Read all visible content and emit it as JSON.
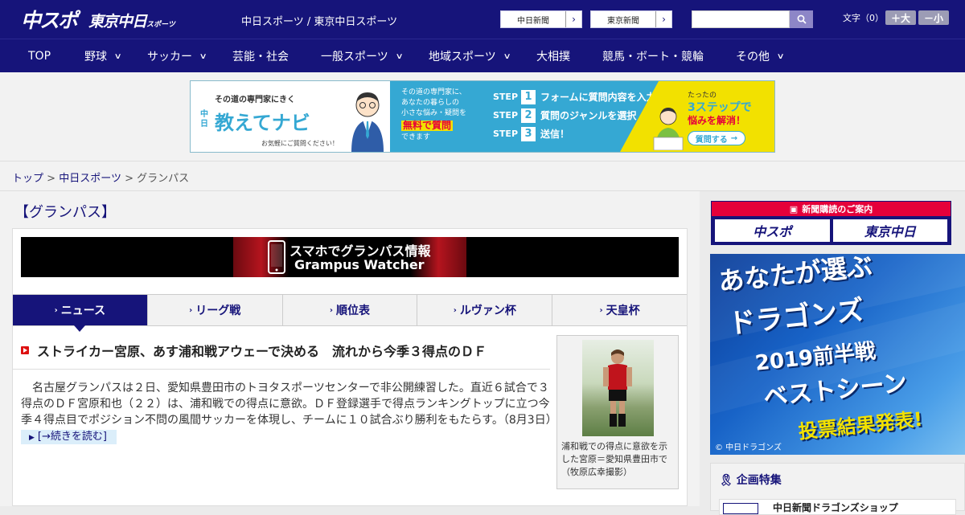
{
  "header": {
    "logo_primary": "中スポ",
    "logo_secondary": "東京中日",
    "logo_secondary_small": "スポーツ",
    "tagline": "中日スポーツ / 東京中日スポーツ",
    "ext_links": [
      {
        "label": "中日新聞"
      },
      {
        "label": "東京新聞"
      }
    ],
    "search": {
      "placeholder": "",
      "icon": "search-icon"
    },
    "font_size": {
      "label": "文字（0）",
      "plus": "＋大",
      "minus": "－小"
    }
  },
  "nav": {
    "items": [
      {
        "label": "TOP",
        "has_menu": false
      },
      {
        "label": "野球",
        "has_menu": true
      },
      {
        "label": "サッカー",
        "has_menu": true
      },
      {
        "label": "芸能・社会",
        "has_menu": false
      },
      {
        "label": "一般スポーツ",
        "has_menu": true
      },
      {
        "label": "地域スポーツ",
        "has_menu": true
      },
      {
        "label": "大相撲",
        "has_menu": false
      },
      {
        "label": "競馬・ボート・競輪",
        "has_menu": false
      },
      {
        "label": "その他",
        "has_menu": true
      }
    ]
  },
  "ad_banner": {
    "kicker": "その道の専門家にきく",
    "brand_small": "中日",
    "brand": "教えてナビ",
    "footnote": "お気軽にご質問ください！",
    "mid_lines": [
      "その道の専門家に、",
      "あなたの暮らしの",
      "小さな悩み・疑問を"
    ],
    "mid_highlight": "無料で質問",
    "mid_tail": "できます",
    "steps": [
      {
        "label": "STEP",
        "num": "1",
        "text": "フォームに質問内容を入力"
      },
      {
        "label": "STEP",
        "num": "2",
        "text": "質問のジャンルを選択"
      },
      {
        "label": "STEP",
        "num": "3",
        "text": "送信！"
      }
    ],
    "right_small": "たったの",
    "right_big": "3ステップで",
    "right_line": "悩みを解消！",
    "right_cta": "質問する"
  },
  "breadcrumb": {
    "items": [
      "トップ",
      "中日スポーツ",
      "グランパス"
    ],
    "separator": ">"
  },
  "main": {
    "category_title": "【グランパス】",
    "gw_banner": {
      "line1": "スマホでグランパス情報",
      "line2": "Grampus Watcher"
    },
    "tabs": [
      {
        "label": "ニュース",
        "active": true
      },
      {
        "label": "リーグ戦",
        "active": false
      },
      {
        "label": "順位表",
        "active": false
      },
      {
        "label": "ルヴァン杯",
        "active": false
      },
      {
        "label": "天皇杯",
        "active": false
      }
    ],
    "article": {
      "title": "ストライカー宮原、あす浦和戦アウェーで決める　流れから今季３得点のＤＦ",
      "body": "　名古屋グランパスは２日、愛知県豊田市のトヨタスポーツセンターで非公開練習した。直近６試合で３得点のＤＦ宮原和也（２２）は、浦和戦での得点に意欲。ＤＦ登録選手で得点ランキングトップに立つ今季４得点目でポジション不問の風間サッカーを体現し、チームに１０試合ぶり勝利をもたらす。（8月3日）",
      "more_label": "[→続きを読む]",
      "photo_caption": "浦和戦での得点に意欲を示した宮原＝愛知県豊田市で（牧原広幸撮影）"
    }
  },
  "sidebar": {
    "subscribe_title": "新聞購読のご案内",
    "subscribe_logos": [
      "中スポ",
      "東京中日"
    ],
    "dragons_ad": {
      "line1": "あなたが選ぶ",
      "line2": "ドラゴンズ",
      "line3": "2019前半戦",
      "line4": "ベストシーン",
      "line5": "投票結果発表!",
      "credit": "© 中日ドラゴンズ"
    },
    "feature_title": "企画特集",
    "feature_item": "中日新聞ドラゴンズショップ"
  },
  "colors": {
    "brand_navy": "#16147a",
    "accent_red": "#e5003a",
    "banner_blue": "#35a8d3",
    "banner_yellow": "#f2e100"
  }
}
